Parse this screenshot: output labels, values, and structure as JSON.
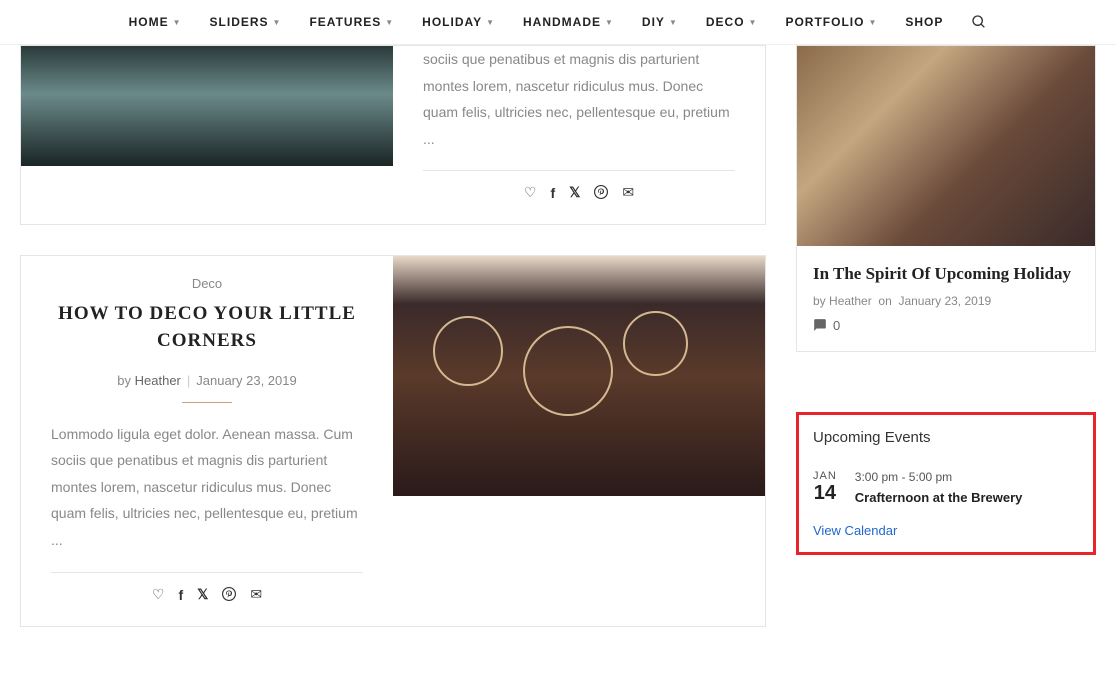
{
  "nav": {
    "items": [
      "HOME",
      "SLIDERS",
      "FEATURES",
      "HOLIDAY",
      "HANDMADE",
      "DIY",
      "DECO",
      "PORTFOLIO"
    ],
    "shop": "SHOP"
  },
  "post1": {
    "excerpt": "sociis que penatibus et magnis dis parturient montes lorem, nascetur ridiculus mus. Donec quam felis, ultricies nec, pellentesque eu, pretium ..."
  },
  "post2": {
    "category": "Deco",
    "title": "HOW TO DECO YOUR LITTLE CORNERS",
    "by": "by",
    "author": "Heather",
    "date": "January 23, 2019",
    "excerpt": "Lommodo ligula eget dolor. Aenean massa. Cum sociis que penatibus et magnis dis parturient montes lorem, nascetur ridiculus mus. Donec quam felis, ultricies nec, pellentesque eu, pretium ..."
  },
  "sidebar": {
    "post": {
      "title": "In The Spirit Of Upcoming Holiday",
      "by": "by",
      "author": "Heather",
      "on": "on",
      "date": "January 23, 2019",
      "comments": "0"
    },
    "events": {
      "title": "Upcoming Events",
      "month": "JAN",
      "day": "14",
      "time": "3:00 pm - 5:00 pm",
      "name": "Crafternoon at the Brewery",
      "view": "View Calendar"
    }
  }
}
